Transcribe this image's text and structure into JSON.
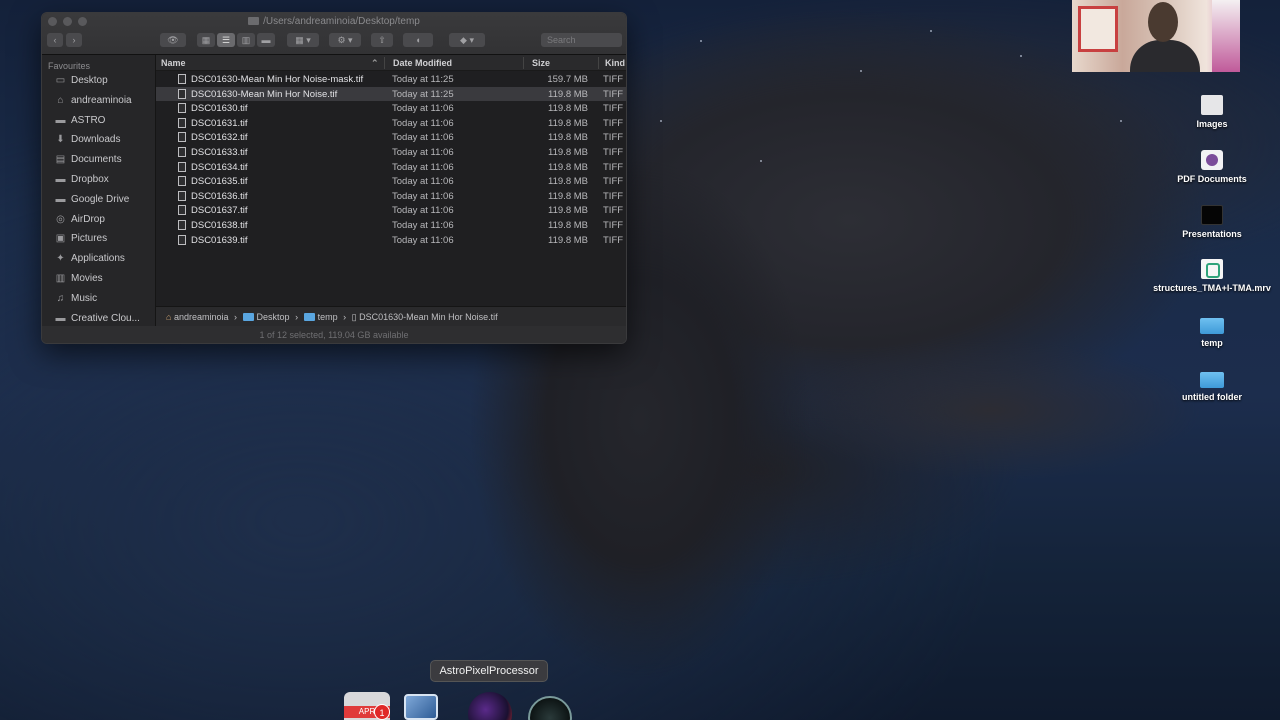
{
  "window": {
    "title": "/Users/andreaminoia/Desktop/temp",
    "search_placeholder": "Search"
  },
  "sidebar": {
    "heading": "Favourites",
    "items": [
      {
        "label": "Desktop",
        "icon": "desktop-icon"
      },
      {
        "label": "andreaminoia",
        "icon": "home-icon"
      },
      {
        "label": "ASTRO",
        "icon": "folder-icon"
      },
      {
        "label": "Downloads",
        "icon": "downloads-icon"
      },
      {
        "label": "Documents",
        "icon": "documents-icon"
      },
      {
        "label": "Dropbox",
        "icon": "dropbox-icon"
      },
      {
        "label": "Google Drive",
        "icon": "google-drive-icon"
      },
      {
        "label": "AirDrop",
        "icon": "airdrop-icon"
      },
      {
        "label": "Pictures",
        "icon": "pictures-icon"
      },
      {
        "label": "Applications",
        "icon": "applications-icon"
      },
      {
        "label": "Movies",
        "icon": "movies-icon"
      },
      {
        "label": "Music",
        "icon": "music-icon"
      },
      {
        "label": "Creative Clou...",
        "icon": "folder-icon"
      }
    ]
  },
  "columns": {
    "name": "Name",
    "date": "Date Modified",
    "size": "Size",
    "kind": "Kind"
  },
  "files": [
    {
      "name": "DSC01630-Mean Min Hor Noise-mask.tif",
      "date": "Today at 11:25",
      "size": "159.7 MB",
      "kind": "TIFF i"
    },
    {
      "name": "DSC01630-Mean Min Hor Noise.tif",
      "date": "Today at 11:25",
      "size": "119.8 MB",
      "kind": "TIFF i"
    },
    {
      "name": "DSC01630.tif",
      "date": "Today at 11:06",
      "size": "119.8 MB",
      "kind": "TIFF i"
    },
    {
      "name": "DSC01631.tif",
      "date": "Today at 11:06",
      "size": "119.8 MB",
      "kind": "TIFF i"
    },
    {
      "name": "DSC01632.tif",
      "date": "Today at 11:06",
      "size": "119.8 MB",
      "kind": "TIFF i"
    },
    {
      "name": "DSC01633.tif",
      "date": "Today at 11:06",
      "size": "119.8 MB",
      "kind": "TIFF i"
    },
    {
      "name": "DSC01634.tif",
      "date": "Today at 11:06",
      "size": "119.8 MB",
      "kind": "TIFF i"
    },
    {
      "name": "DSC01635.tif",
      "date": "Today at 11:06",
      "size": "119.8 MB",
      "kind": "TIFF i"
    },
    {
      "name": "DSC01636.tif",
      "date": "Today at 11:06",
      "size": "119.8 MB",
      "kind": "TIFF i"
    },
    {
      "name": "DSC01637.tif",
      "date": "Today at 11:06",
      "size": "119.8 MB",
      "kind": "TIFF i"
    },
    {
      "name": "DSC01638.tif",
      "date": "Today at 11:06",
      "size": "119.8 MB",
      "kind": "TIFF i"
    },
    {
      "name": "DSC01639.tif",
      "date": "Today at 11:06",
      "size": "119.8 MB",
      "kind": "TIFF i"
    }
  ],
  "selected_index": 1,
  "pathbar": {
    "home": "andreaminoia",
    "desktop": "Desktop",
    "temp": "temp",
    "file": "DSC01630-Mean Min Hor Noise.tif"
  },
  "status": "1 of 12 selected, 119.04 GB available",
  "desktop_icons": [
    {
      "label": "Images",
      "icon": "document-icon"
    },
    {
      "label": "PDF Documents",
      "icon": "pdf-icon"
    },
    {
      "label": "Presentations",
      "icon": "presentation-icon"
    },
    {
      "label": "structures_TMA+I-TMA.mrv",
      "icon": "mrv-file-icon"
    },
    {
      "label": "temp",
      "icon": "folder-icon"
    },
    {
      "label": "untitled folder",
      "icon": "folder-icon"
    }
  ],
  "dock": {
    "tooltip": "AstroPixelProcessor",
    "calendar_month": "APR",
    "calendar_badge": "1"
  },
  "colors": {
    "selection": "#3a3a3e",
    "folder_blue": "#5aa6e0",
    "accent_red": "#e03a3a"
  }
}
